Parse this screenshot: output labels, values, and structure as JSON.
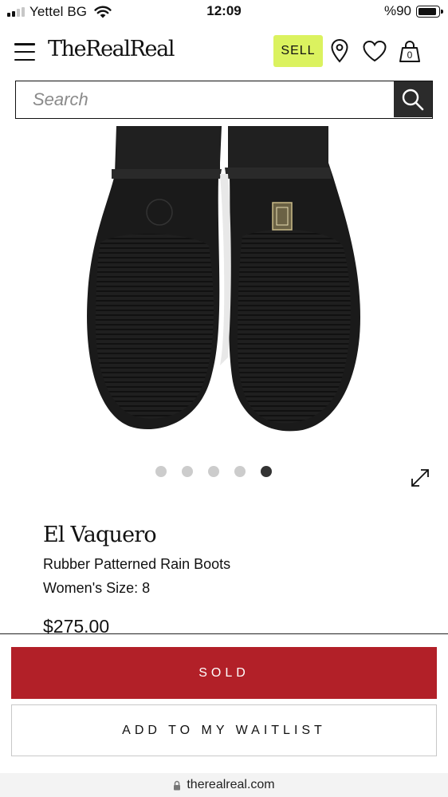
{
  "status_bar": {
    "carrier": "Yettel BG",
    "time": "12:09",
    "battery": "%90",
    "battery_level": 0.9
  },
  "header": {
    "logo": "TheRealReal",
    "sell_label": "SELL",
    "sell_color": "#dbf25f",
    "cart_count": "0",
    "icons": [
      "menu-icon",
      "location-pin-icon",
      "heart-icon",
      "shopping-bag-icon"
    ]
  },
  "search": {
    "placeholder": "Search",
    "value": "",
    "icon": "search-icon"
  },
  "gallery": {
    "image": "rubber rain boots soles photo",
    "dot_count": 5,
    "active_index": 4,
    "expand_icon": "expand-arrows-icon"
  },
  "product": {
    "brand": "El Vaquero",
    "name": "Rubber Patterned Rain Boots",
    "size": "Women's Size: 8",
    "price": "$275.00"
  },
  "actions": {
    "sold_label": "SOLD",
    "sold_color": "#b22028",
    "waitlist_label": "ADD TO MY WAITLIST"
  },
  "browser": {
    "url": "therealreal.com",
    "icon": "lock-icon"
  }
}
